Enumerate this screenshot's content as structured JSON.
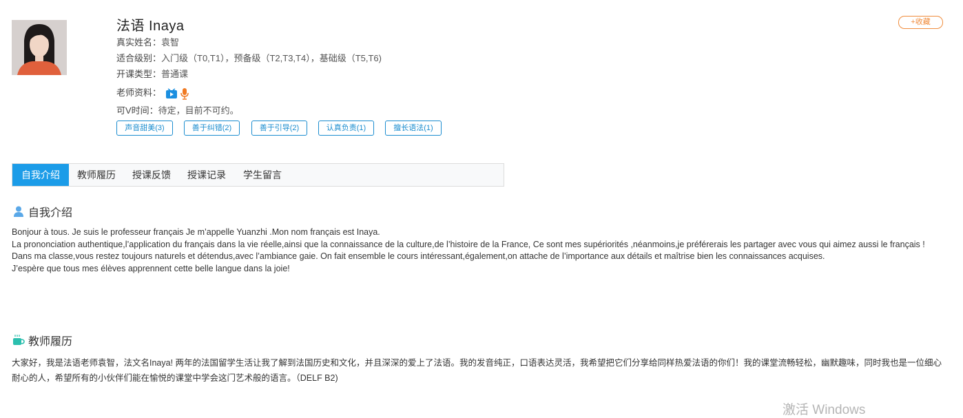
{
  "teacher": {
    "name": "法语 Inaya",
    "fields": {
      "real_name_label": "真实姓名：",
      "real_name": "袁智",
      "level_label": "适合级别：",
      "level": "入门级（T0,T1），预备级（T2,T3,T4），基础级（T5,T6)",
      "course_type_label": "开课类型：",
      "course_type": "普通课",
      "materials_label": "老师资料：",
      "availability_label": "可V时间：",
      "availability": "待定，目前不可约。"
    },
    "favorite_label": "+收藏",
    "tags": [
      "声音甜美(3)",
      "善于纠错(2)",
      "善于引导(2)",
      "认真负责(1)",
      "擅长语法(1)"
    ]
  },
  "tabs": [
    "自我介绍",
    "教师履历",
    "授课反馈",
    "授课记录",
    "学生留言"
  ],
  "active_tab": "自我介绍",
  "self_intro": {
    "title": "自我介绍",
    "lines": [
      " Bonjour à tous. Je suis le professeur français Je m’appelle Yuanzhi .Mon nom français est Inaya.",
      "La prononciation authentique,l’application du français dans la vie réelle,ainsi que la connaissance de la culture,de l’histoire de la France, Ce sont mes supériorités ,néanmoins,je préférerais les partager avec vous qui aimez aussi le français !",
      "Dans ma classe,vous restez toujours naturels et détendus,avec l’ambiance gaie. On fait ensemble le cours intéressant,également,on attache de l’importance aux détails et maîtrise bien les connaissances acquises.",
      "J’espère que tous mes élèves apprennent cette belle langue dans la joie!"
    ]
  },
  "resume": {
    "title": "教师履历",
    "text": " 大家好，我是法语老师袁智，法文名Inaya! 两年的法国留学生活让我了解到法国历史和文化，并且深深的爱上了法语。我的发音纯正，口语表达灵活，我希望把它们分享给同样热爱法语的你们！我的课堂流畅轻松，幽默趣味，同时我也是一位细心耐心的人，希望所有的小伙伴们能在愉悦的课堂中学会这门艺术般的语言。（DELF B2)"
  },
  "watermark": "激活 Windows",
  "colors": {
    "accent": "#1b9ce8",
    "tag": "#1a8ccf",
    "favorite": "#f08c3c"
  },
  "icons": {
    "video": "video-icon",
    "audio": "microphone-icon",
    "user": "user-icon",
    "cup": "cup-icon"
  }
}
